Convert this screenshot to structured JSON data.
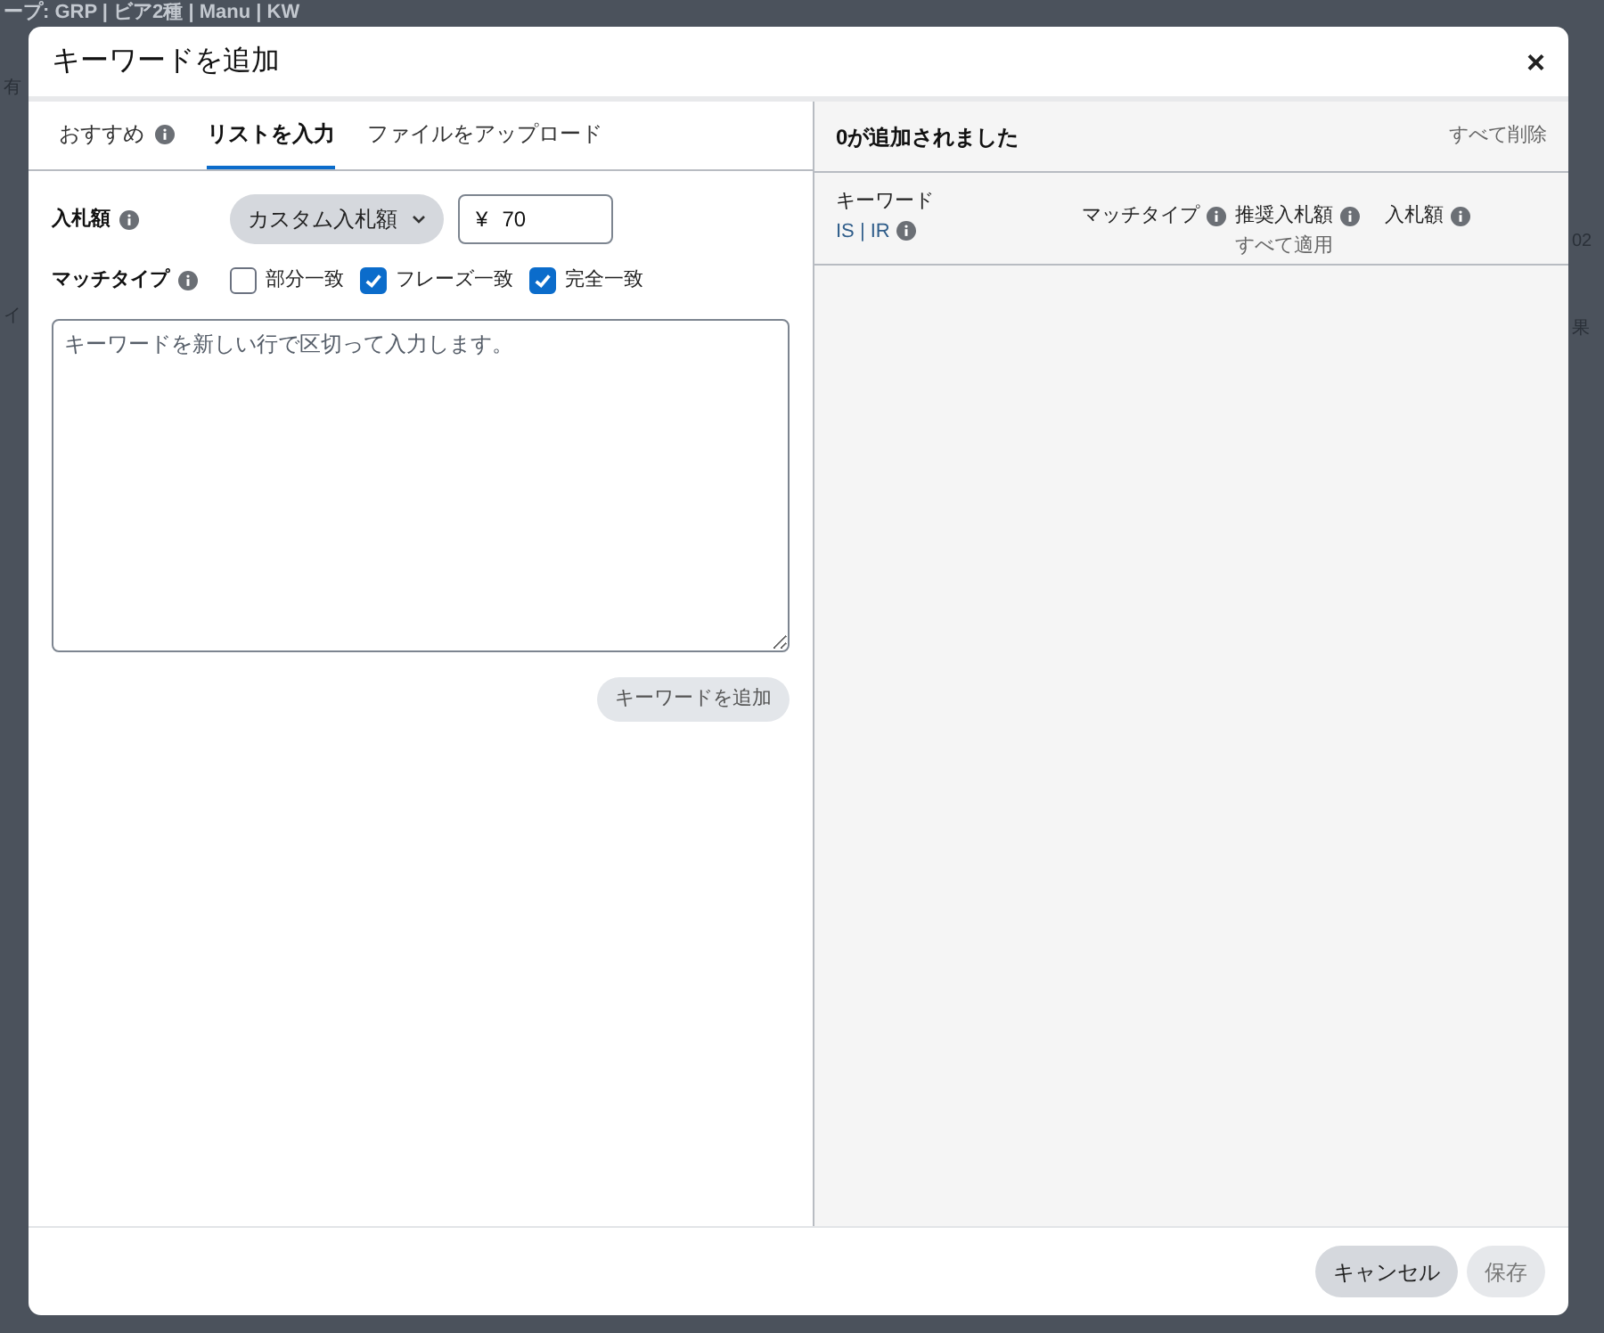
{
  "background": {
    "title": "ープ: GRP | ビア2種 | Manu | KW",
    "fragments": [
      "有",
      "イ",
      "02",
      "果"
    ]
  },
  "dialog": {
    "title": "キーワードを追加",
    "close": "×"
  },
  "tabs": [
    {
      "label": "おすすめ",
      "info": true,
      "selected": false
    },
    {
      "label": "リストを入力",
      "info": false,
      "selected": true
    },
    {
      "label": "ファイルをアップロード",
      "info": false,
      "selected": false
    }
  ],
  "bid": {
    "label": "入札額",
    "dropdown": "カスタム入札額",
    "currency": "¥",
    "value": "70"
  },
  "match_type": {
    "label": "マッチタイプ",
    "options": [
      {
        "label": "部分一致",
        "checked": false
      },
      {
        "label": "フレーズ一致",
        "checked": true
      },
      {
        "label": "完全一致",
        "checked": true
      }
    ]
  },
  "keywords_box": {
    "placeholder": "キーワードを新しい行で区切って入力します。"
  },
  "add_button": "キーワードを追加",
  "added": {
    "title": "0が追加されました",
    "clear_all": "すべて削除",
    "columns": [
      {
        "label": "キーワード",
        "sub": "IS | IR",
        "info": false,
        "sub_info": true
      },
      {
        "label": "マッチタイプ",
        "info": true
      },
      {
        "label": "推奨入札額",
        "info": true,
        "sub": "すべて適用"
      },
      {
        "label": "入札額",
        "info": true
      }
    ]
  },
  "footer": {
    "buttons": [
      {
        "label": "キャンセル",
        "disabled": false
      },
      {
        "label": "保存",
        "disabled": true
      }
    ]
  }
}
